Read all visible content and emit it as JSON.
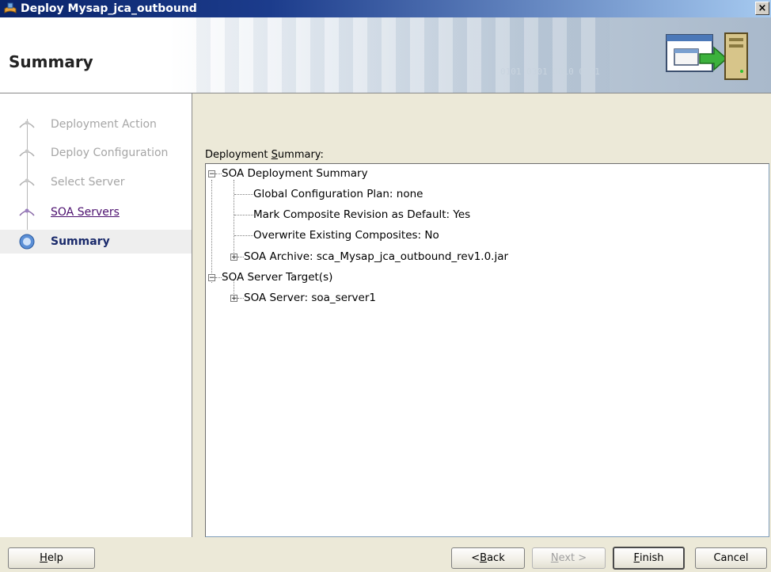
{
  "window": {
    "title": "Deploy Mysap_jca_outbound",
    "close_glyph": "×"
  },
  "header": {
    "page_title": "Summary",
    "binary_text": "0101 0301 0010 0101"
  },
  "nav": {
    "items": [
      {
        "label": "Deployment Action",
        "state": "disabled"
      },
      {
        "label": "Deploy Configuration",
        "state": "disabled"
      },
      {
        "label": "Select Server",
        "state": "disabled"
      },
      {
        "label": "SOA Servers",
        "state": "link"
      },
      {
        "label": "Summary",
        "state": "active"
      }
    ]
  },
  "content": {
    "label_prefix": "Deployment ",
    "label_mnemonic": "S",
    "label_suffix": "ummary:",
    "tree": {
      "root1": "SOA Deployment Summary",
      "root1_children": [
        "Global Configuration Plan: none",
        "Mark Composite Revision as Default: Yes",
        "Overwrite Existing Composites: No",
        "SOA Archive: sca_Mysap_jca_outbound_rev1.0.jar"
      ],
      "root2": "SOA Server Target(s)",
      "root2_children": [
        "SOA Server: soa_server1"
      ],
      "expanded_glyph": "−",
      "collapsed_glyph": "+"
    }
  },
  "buttons": {
    "help": {
      "mnemonic": "H",
      "rest": "elp"
    },
    "back": {
      "prefix": "< ",
      "mnemonic": "B",
      "rest": "ack"
    },
    "next": {
      "mnemonic": "N",
      "rest": "ext >"
    },
    "finish": {
      "mnemonic": "F",
      "rest": "inish"
    },
    "cancel": "Cancel"
  },
  "colors": {
    "titlebar": "#0a246a",
    "link": "#4b0f6e",
    "active_step": "#1a2a6b",
    "dialog_bg": "#ece9d8"
  }
}
